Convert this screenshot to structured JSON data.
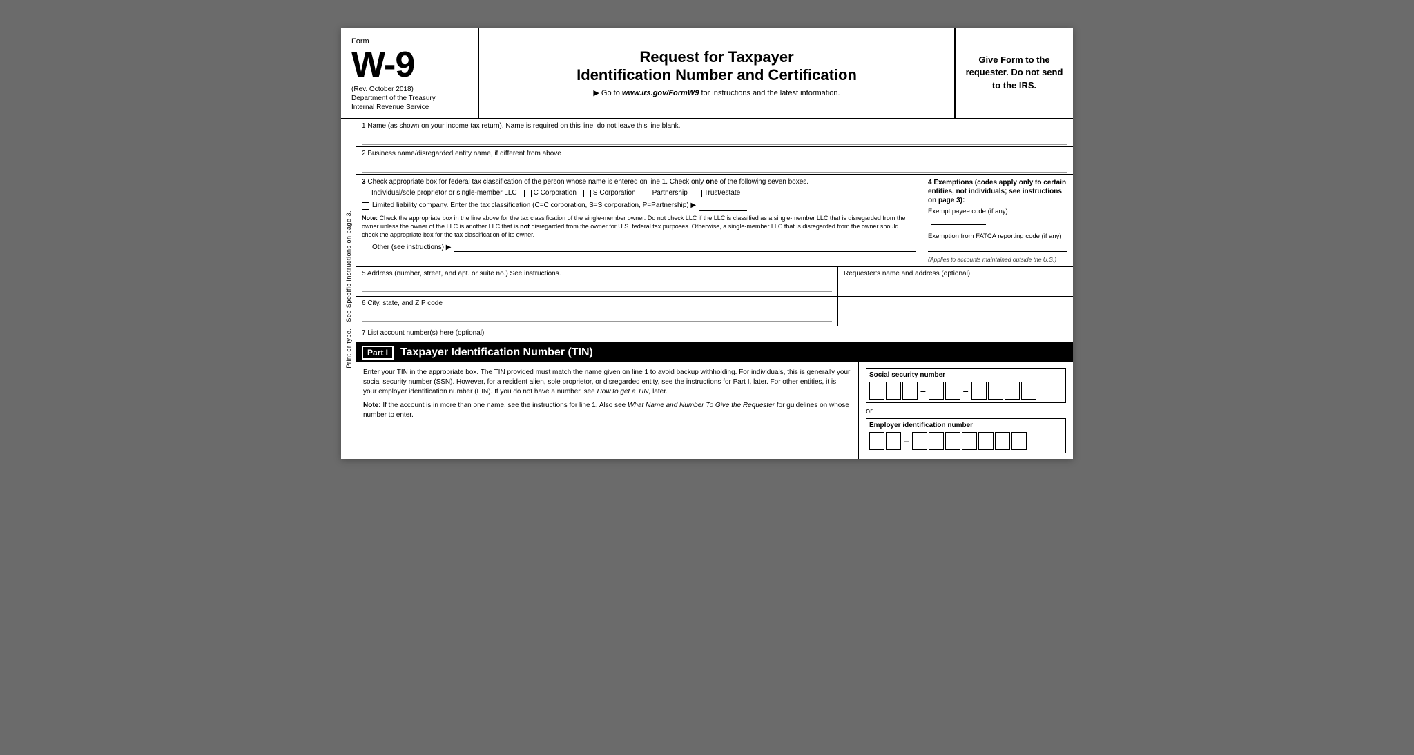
{
  "header": {
    "form_label": "Form",
    "form_number": "W-9",
    "rev": "(Rev. October 2018)",
    "dept1": "Department of the Treasury",
    "dept2": "Internal Revenue Service",
    "title_line1": "Request for Taxpayer",
    "title_line2": "Identification Number and Certification",
    "goto_text": "▶ Go to",
    "goto_url": "www.irs.gov/FormW9",
    "goto_suffix": "for instructions and the latest information.",
    "give_form": "Give Form to the requester. Do not send to the IRS."
  },
  "side_label": {
    "line1": "Print or type.",
    "line2": "See Specific Instructions on page 3."
  },
  "field1": {
    "label": "1  Name (as shown on your income tax return). Name is required on this line; do not leave this line blank."
  },
  "field2": {
    "label": "2  Business name/disregarded entity name, if different from above"
  },
  "field3": {
    "label_num": "3",
    "label_text": "Check appropriate box for federal tax classification of the person whose name is entered on line 1. Check only",
    "label_one": "one",
    "label_text2": "of the following seven boxes.",
    "cb_individual": "Individual/sole proprietor or single-member LLC",
    "cb_c_corp": "C Corporation",
    "cb_s_corp": "S Corporation",
    "cb_partnership": "Partnership",
    "cb_trust": "Trust/estate",
    "llc_label": "Limited liability company. Enter the tax classification (C=C corporation, S=S corporation, P=Partnership) ▶",
    "note_label": "Note:",
    "note_text": "Check the appropriate box in the line above for the tax classification of the single-member owner.  Do not check LLC if the LLC is classified as a single-member LLC that is disregarded from the owner unless the owner of the LLC is another LLC that is",
    "note_not": "not",
    "note_text2": "disregarded from the owner for U.S. federal tax purposes. Otherwise, a single-member LLC that is disregarded from the owner should check the appropriate box for the tax classification of its owner.",
    "other_label": "Other (see instructions) ▶"
  },
  "field4": {
    "title": "4  Exemptions (codes apply only to certain entities, not individuals; see instructions on page 3):",
    "exempt_label": "Exempt payee code (if any)",
    "fatca_label": "Exemption from FATCA reporting code (if any)",
    "applies_note": "(Applies to accounts maintained outside the U.S.)"
  },
  "field5": {
    "label": "5  Address (number, street, and apt. or suite no.) See instructions.",
    "requester_label": "Requester's name and address (optional)"
  },
  "field6": {
    "label": "6  City, state, and ZIP code"
  },
  "field7": {
    "label": "7  List account number(s) here (optional)"
  },
  "part1": {
    "badge": "Part I",
    "title": "Taxpayer Identification Number (TIN)",
    "body_text": "Enter your TIN in the appropriate box. The TIN provided must match the name given on line 1 to avoid backup withholding. For individuals, this is generally your social security number (SSN). However, for a resident alien, sole proprietor, or disregarded entity, see the instructions for Part I, later. For other entities, it is your employer identification number (EIN). If you do not have a number, see",
    "how_to_get": "How to get a TIN,",
    "body_text2": "later.",
    "note_label": "Note:",
    "note_text": "If the account is in more than one name, see the instructions for line 1. Also see",
    "what_name": "What Name and Number To Give the Requester",
    "note_text2": "for guidelines on whose number to enter.",
    "ssn_label": "Social security number",
    "ein_label": "Employer identification number",
    "or_text": "or"
  }
}
